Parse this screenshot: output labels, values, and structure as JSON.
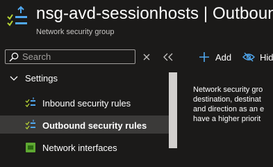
{
  "header": {
    "title": "nsg-avd-sessionhosts | Outbound",
    "subtitle": "Network security group"
  },
  "search": {
    "placeholder": "Search"
  },
  "toolbar": {
    "add_label": "Add",
    "hide_label": "Hid"
  },
  "sidebar": {
    "group_label": "Settings",
    "items": [
      {
        "label": "Inbound security rules",
        "icon": "security-rules-icon"
      },
      {
        "label": "Outbound security rules",
        "icon": "security-rules-icon",
        "selected": true
      },
      {
        "label": "Network interfaces",
        "icon": "network-interface-icon"
      }
    ]
  },
  "content": {
    "lines": [
      "Network security gro",
      "destination, destinat",
      "and direction as an e",
      "have a higher priorit"
    ]
  },
  "colors": {
    "accent": "#0078d4",
    "background": "#1b1a19",
    "selected": "#3b3a39"
  }
}
